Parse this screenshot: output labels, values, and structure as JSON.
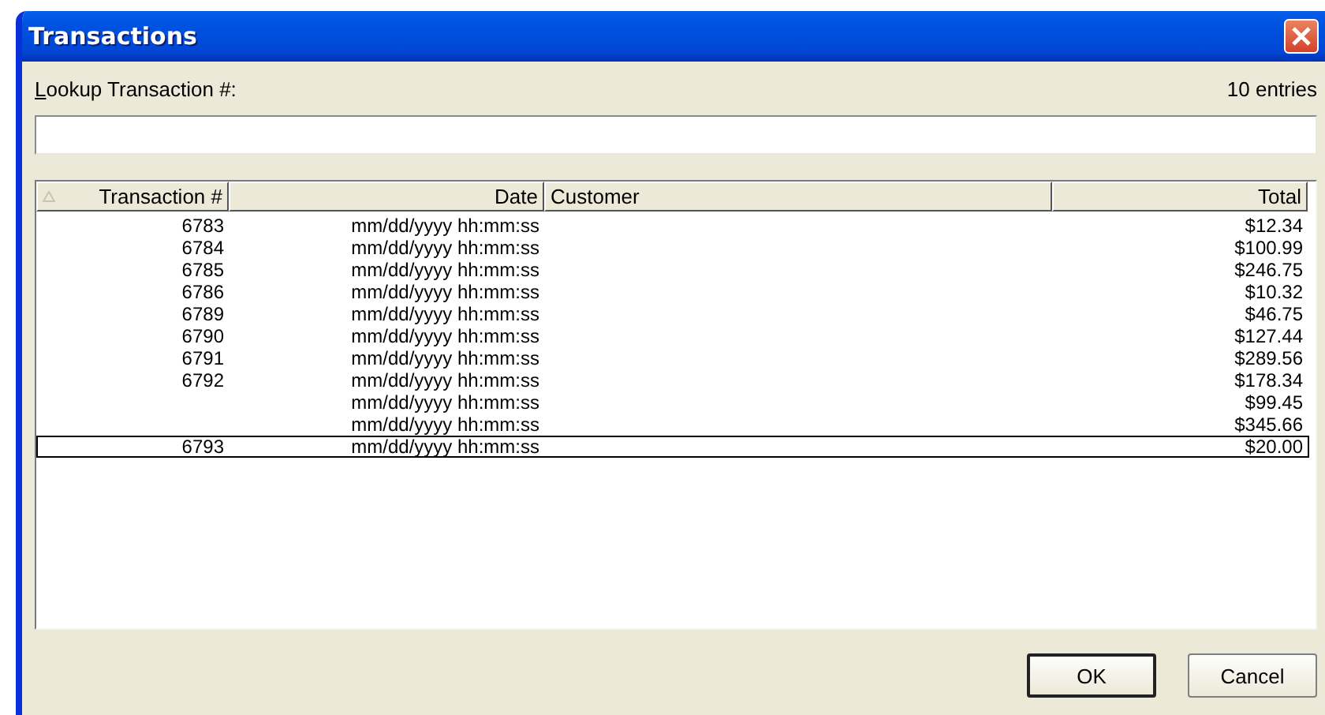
{
  "window": {
    "title": "Transactions"
  },
  "lookup": {
    "label": "Lookup Transaction #:",
    "count": "10 entries"
  },
  "table": {
    "columns": [
      {
        "label": "Transaction #",
        "sorted": true
      },
      {
        "label": "Date",
        "sorted": false
      },
      {
        "label": "Customer",
        "sorted": false
      },
      {
        "label": "Total",
        "sorted": false
      }
    ],
    "rows": [
      {
        "transaction": "6783",
        "date": "mm/dd/yyyy hh:mm:ss",
        "total": "$12.34",
        "selected": false
      },
      {
        "transaction": "6784",
        "date": "mm/dd/yyyy hh:mm:ss",
        "total": "$100.99",
        "selected": false
      },
      {
        "transaction": "6785",
        "date": "mm/dd/yyyy hh:mm:ss",
        "total": "$246.75",
        "selected": false
      },
      {
        "transaction": "6786",
        "date": "mm/dd/yyyy hh:mm:ss",
        "total": "$10.32",
        "selected": false
      },
      {
        "transaction": "6789",
        "date": "mm/dd/yyyy hh:mm:ss",
        "total": "$46.75",
        "selected": false
      },
      {
        "transaction": "6790",
        "date": "mm/dd/yyyy hh:mm:ss",
        "total": "$127.44",
        "selected": false
      },
      {
        "transaction": "6791",
        "date": "mm/dd/yyyy hh:mm:ss",
        "total": "$289.56",
        "selected": false
      },
      {
        "transaction": "6792",
        "date": "mm/dd/yyyy hh:mm:ss",
        "total": "$178.34",
        "selected": false
      },
      {
        "date": "mm/dd/yyyy hh:mm:ss",
        "total": "$99.45",
        "selected": false
      },
      {
        "date": "mm/dd/yyyy hh:mm:ss",
        "total": "$345.66",
        "selected": false
      },
      {
        "transaction": "6793",
        "date": "mm/dd/yyyy hh:mm:ss",
        "total": "$20.00",
        "selected": true
      }
    ]
  },
  "buttons": [
    {
      "label": "OK",
      "default": true
    },
    {
      "label": "Cancel",
      "default": false
    }
  ]
}
